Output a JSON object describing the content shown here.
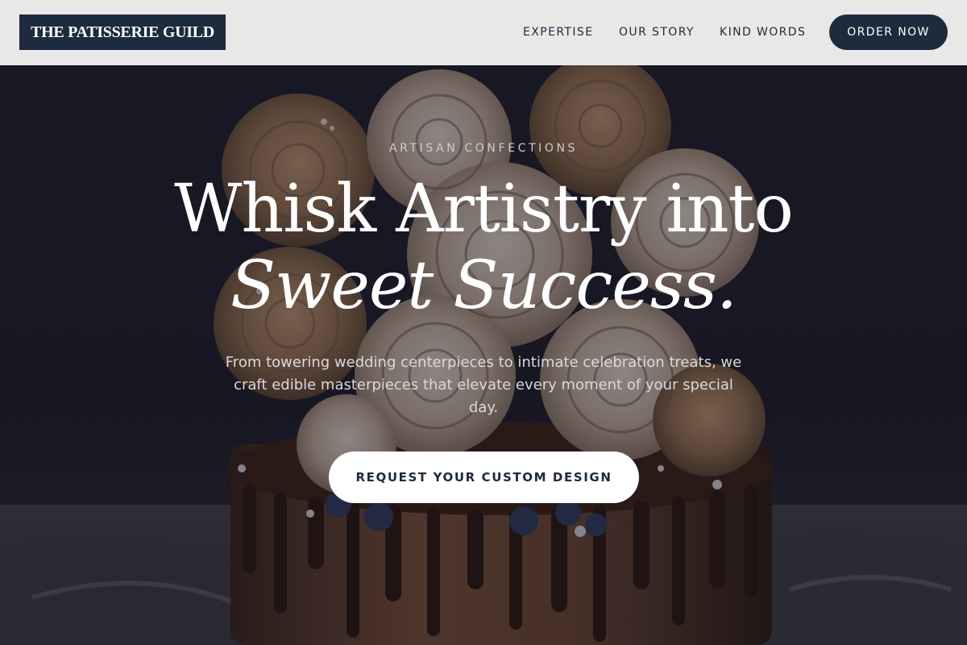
{
  "header": {
    "logo": "THE PATISSERIE GUILD",
    "nav": [
      {
        "label": "EXPERTISE"
      },
      {
        "label": "OUR STORY"
      },
      {
        "label": "KIND WORDS"
      }
    ],
    "cta": "ORDER NOW"
  },
  "hero": {
    "eyebrow": "ARTISAN CONFECTIONS",
    "title_line1": "Whisk Artistry into",
    "title_line2": "Sweet Success.",
    "subtitle": "From towering wedding centerpieces to intimate celebration treats, we craft edible masterpieces that elevate every moment of your special day.",
    "cta": "REQUEST YOUR CUSTOM DESIGN",
    "background_image": "chocolate-drip-cake-with-meringue-rosettes"
  },
  "colors": {
    "navy": "#1e2a3d",
    "header_bg": "#e8e8e8",
    "hero_bg": "#1b1a26",
    "white": "#ffffff"
  }
}
